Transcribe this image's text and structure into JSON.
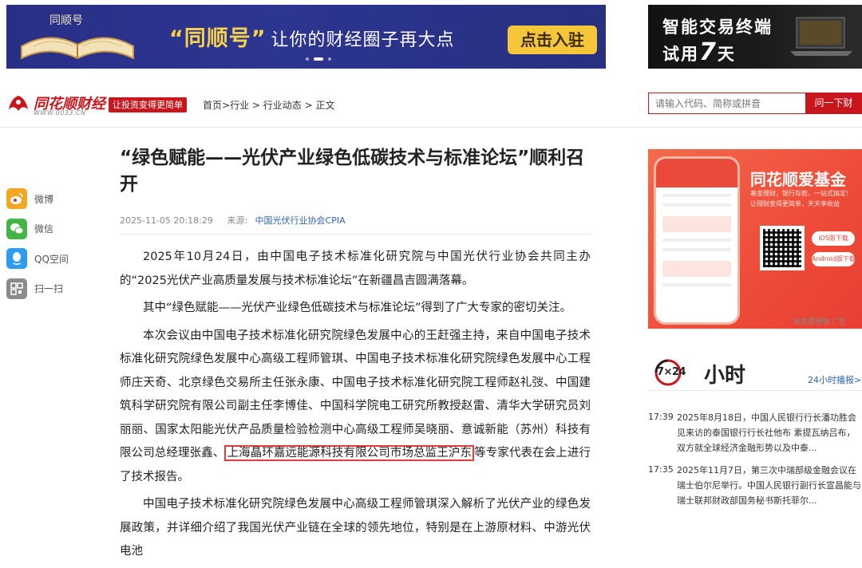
{
  "banner_left": {
    "book_label": "同顺号",
    "slogan": "“同顺号”",
    "slogan_tail": "让你的财经圈子再大点",
    "cta": "点击入驻"
  },
  "banner_right": {
    "line1": "智能交易终端",
    "line2_prefix": "试用",
    "line2_big": "7",
    "line2_suffix": "天"
  },
  "nav": {
    "logo_text": "同花顺财经",
    "logo_sub": "WWW.0033.CN",
    "logo_tag": "让投资变得更简单",
    "breadcrumb": [
      "首页",
      ">",
      "行业",
      " > ",
      "行业动态",
      " > ",
      "正文"
    ],
    "search_placeholder": "请输入代码、简称或拼音",
    "search_button": "问一下财"
  },
  "share": [
    {
      "label": "微博",
      "icon": "weibo-icon",
      "color": "#f5a623"
    },
    {
      "label": "微信",
      "icon": "wechat-icon",
      "color": "#44b549"
    },
    {
      "label": "QQ空间",
      "icon": "qzone-icon",
      "color": "#2d9cf0"
    },
    {
      "label": "扫一扫",
      "icon": "qrcode-icon",
      "color": "#8b8b8b"
    }
  ],
  "article": {
    "title": "“绿色赋能——光伏产业绿色低碳技术与标准论坛”顺利召开",
    "date": "2025-11-05 20:18:29",
    "source_label": "来源:",
    "source": "中国光伏行业协会CPIA",
    "p1": "2025年10月24日，由中国电子技术标准化研究院与中国光伏行业协会共同主办的“2025光伏产业高质量发展与技术标准论坛”在新疆昌吉圆满落幕。",
    "p2": "其中“绿色赋能——光伏产业绿色低碳技术与标准论坛”得到了广大专家的密切关注。",
    "p3_before": "本次会议由中国电子技术标准化研究院绿色发展中心的王赶强主持，来自中国电子技术标准化研究院绿色发展中心高级工程师管琪、中国电子技术标准化研究院绿色发展中心工程师庄天奇、北京绿色交易所主任张永康、中国电子技术标准化研究院工程师赵礼弢、中国建筑科学研究院有限公司副主任李博佳、中国科学院电工研究所教授赵雷、清华大学研究员刘丽丽、国家太阳能光伏产品质量检验检测中心高级工程师吴晓丽、意诚新能（苏州）科技有限公司总经理张鑫、",
    "p3_highlight": "上海晶环嘉远能源科技有限公司市场总监王沪东",
    "p3_after": "等专家代表在会上进行了技术报告。",
    "p4": "中国电子技术标准化研究院绿色发展中心高级工程师管琪深入解析了光伏产业的绿色发展政策，并详细介绍了我国光伏产业链在全球的领先地位，特别是在上游原材料、中游光伏电池"
  },
  "app_ad": {
    "title": "同花顺爱基金",
    "sub1": "基金理财，银行存款，一站式搞定!",
    "sub2": "让理财变得更简单，天天享收益",
    "ios_button": "iOS版下载",
    "android_button": "Android版下载",
    "tag": "投资需谨慎  广告"
  },
  "news": {
    "badge": "7×24",
    "title": "小时",
    "more_link": "24小时播报>>",
    "items": [
      {
        "time": "17:39",
        "text": "2025年8月18日，中国人民银行行长潘功胜会见来访的泰国银行行长社他布 素提瓦纳吕布，双方就全球经济金融形势以及中泰..."
      },
      {
        "time": "17:35",
        "text": "2025年11月7日，第三次中瑞部级金融会议在瑞士伯尔尼举行。中国人民银行副行长宣昌能与瑞士联邦财政部国务秘书斯托菲尔..."
      }
    ]
  }
}
